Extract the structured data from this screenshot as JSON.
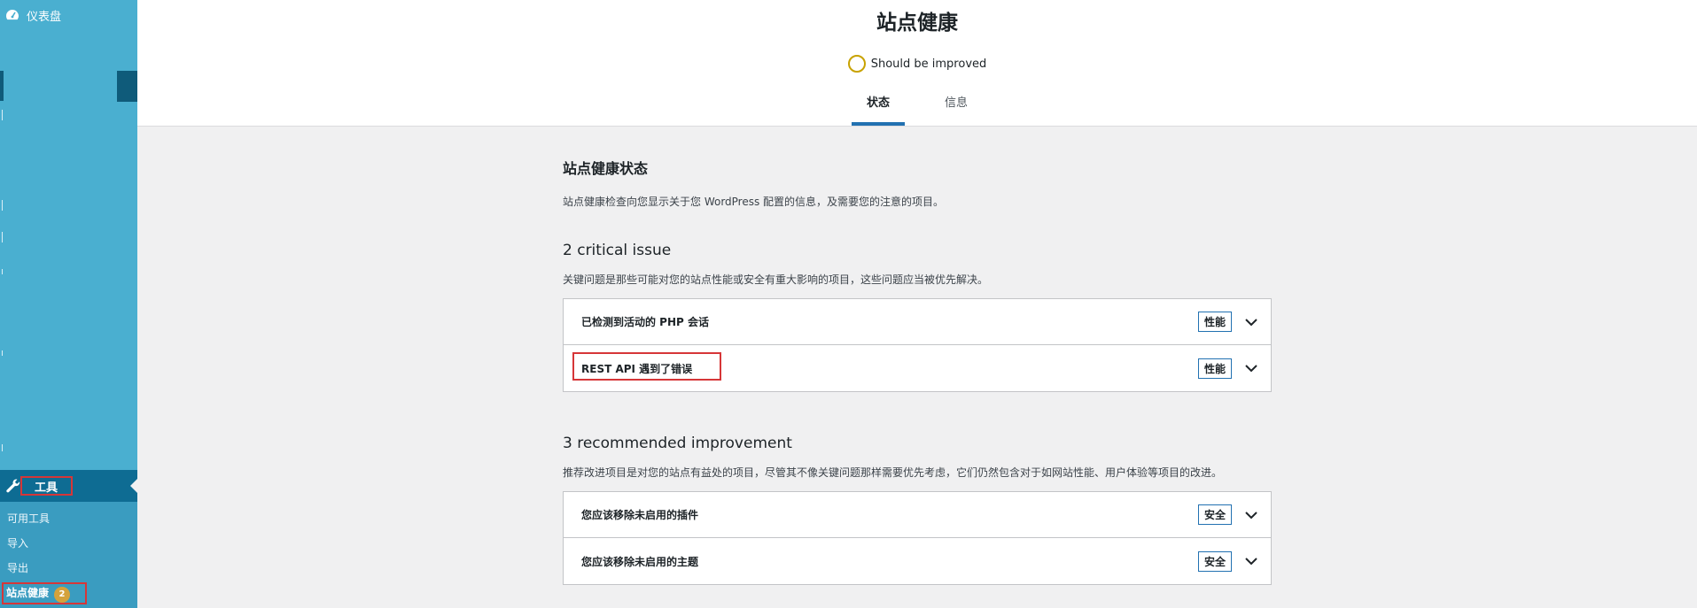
{
  "sidebar": {
    "dashboard_label": "仪表盘",
    "tools_label": "工具",
    "submenu": [
      {
        "label": "可用工具"
      },
      {
        "label": "导入"
      },
      {
        "label": "导出"
      },
      {
        "label": "站点健康",
        "badge": "2"
      }
    ]
  },
  "header": {
    "title": "站点健康",
    "status_text": "Should be improved",
    "tabs": [
      {
        "label": "状态",
        "active": true
      },
      {
        "label": "信息",
        "active": false
      }
    ]
  },
  "main": {
    "heading": "站点健康状态",
    "intro": "站点健康检查向您显示关于您 WordPress 配置的信息，及需要您的注意的项目。",
    "critical": {
      "heading": "2 critical issue",
      "desc": "关键问题是那些可能对您的站点性能或安全有重大影响的项目，这些问题应当被优先解决。",
      "items": [
        {
          "title": "已检测到活动的 PHP 会话",
          "tag": "性能"
        },
        {
          "title": "REST API 遇到了错误",
          "tag": "性能"
        }
      ]
    },
    "recommended": {
      "heading": "3 recommended improvement",
      "desc": "推荐改进项目是对您的站点有益处的项目，尽管其不像关键问题那样需要优先考虑，它们仍然包含对于如网站性能、用户体验等项目的改进。",
      "items": [
        {
          "title": "您应该移除未启用的插件",
          "tag": "安全"
        },
        {
          "title": "您应该移除未启用的主题",
          "tag": "安全"
        }
      ]
    }
  },
  "colors": {
    "sidebar": "#4aafd0",
    "accent": "#2271b1",
    "highlight": "#d63638",
    "status_ring": "#c8a200"
  }
}
